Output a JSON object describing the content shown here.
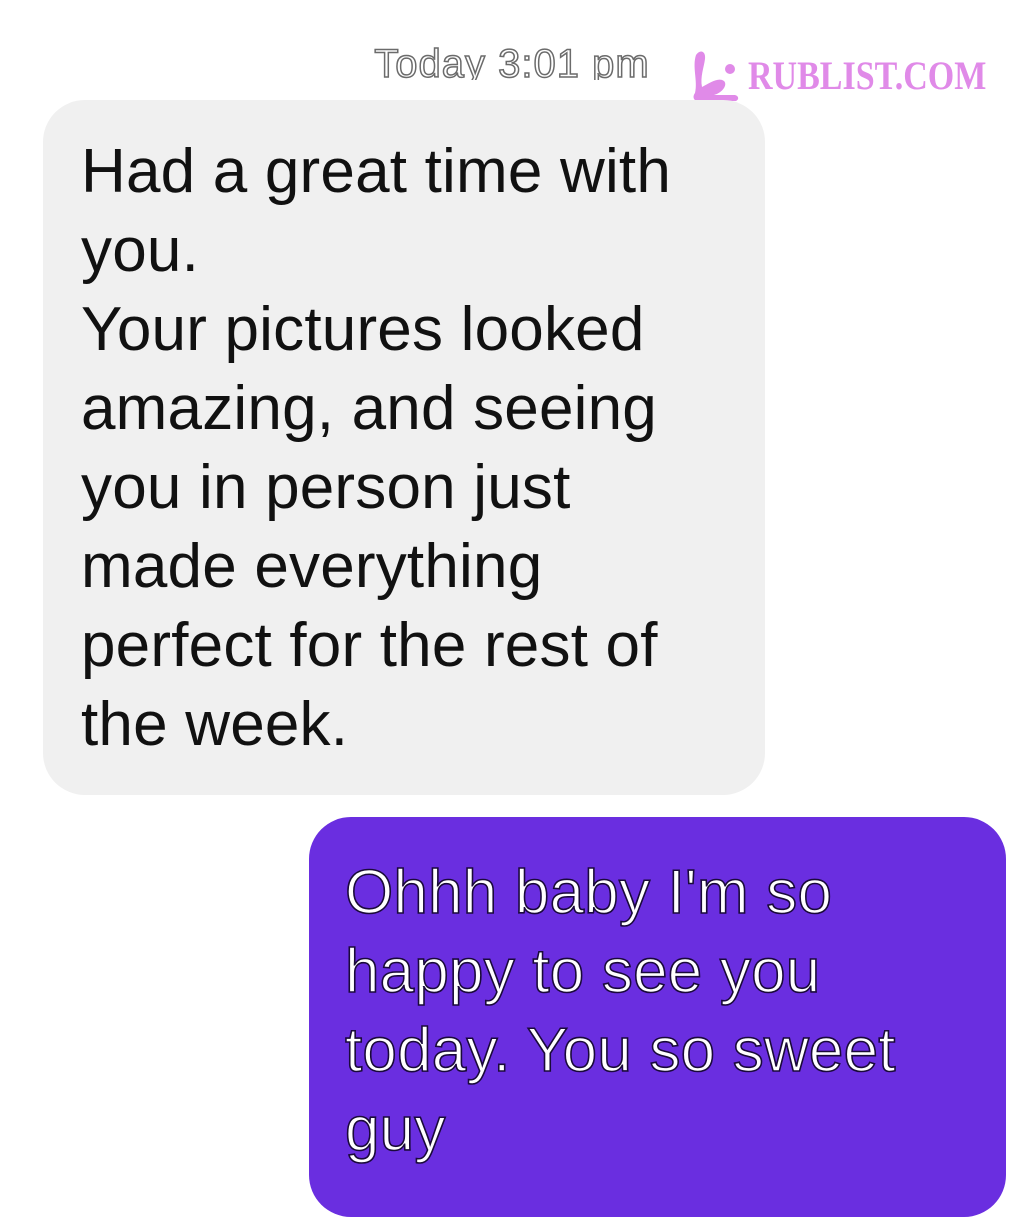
{
  "conversation": {
    "timestamp": "Today 3:01 pm",
    "messages": [
      {
        "direction": "incoming",
        "text": "Had a great time with\nyou.\nYour pictures looked\namazing, and seeing\nyou in person just\nmade everything\nperfect for the rest of\nthe week."
      },
      {
        "direction": "outgoing",
        "text": "Ohhh baby I'm so\nhappy to see you\ntoday. You so sweet\nguy"
      }
    ]
  },
  "watermark": {
    "text": "RUBLIST.COM",
    "color": "#e08ae8"
  },
  "colors": {
    "incoming_bubble": "#f0f0f0",
    "outgoing_bubble": "#6a2ee0"
  }
}
